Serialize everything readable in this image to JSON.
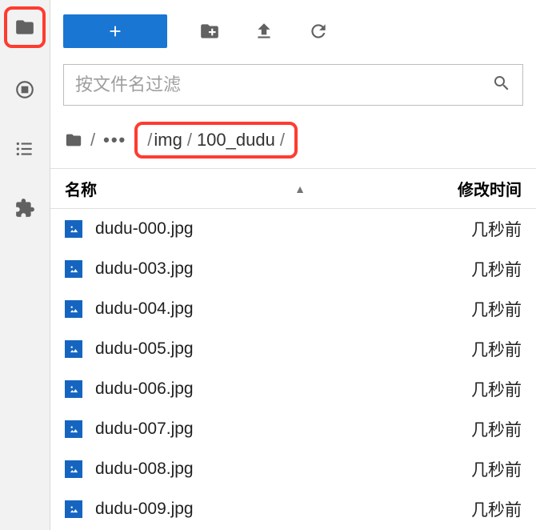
{
  "sidebar": {
    "items": [
      {
        "name": "folder-icon"
      },
      {
        "name": "running-icon"
      },
      {
        "name": "list-icon"
      },
      {
        "name": "extension-icon"
      }
    ]
  },
  "toolbar": {
    "new_button": "+",
    "new_folder": "folder-plus",
    "upload": "upload",
    "refresh": "refresh"
  },
  "filter": {
    "placeholder": "按文件名过滤"
  },
  "breadcrumb": {
    "ellipsis": "•••",
    "path_1": "img",
    "path_2": "100_dudu",
    "sep": "/"
  },
  "table": {
    "col_name": "名称",
    "col_modified": "修改时间",
    "sort_indicator": "▲"
  },
  "files": [
    {
      "name": "dudu-000.jpg",
      "modified": "几秒前"
    },
    {
      "name": "dudu-003.jpg",
      "modified": "几秒前"
    },
    {
      "name": "dudu-004.jpg",
      "modified": "几秒前"
    },
    {
      "name": "dudu-005.jpg",
      "modified": "几秒前"
    },
    {
      "name": "dudu-006.jpg",
      "modified": "几秒前"
    },
    {
      "name": "dudu-007.jpg",
      "modified": "几秒前"
    },
    {
      "name": "dudu-008.jpg",
      "modified": "几秒前"
    },
    {
      "name": "dudu-009.jpg",
      "modified": "几秒前"
    }
  ]
}
